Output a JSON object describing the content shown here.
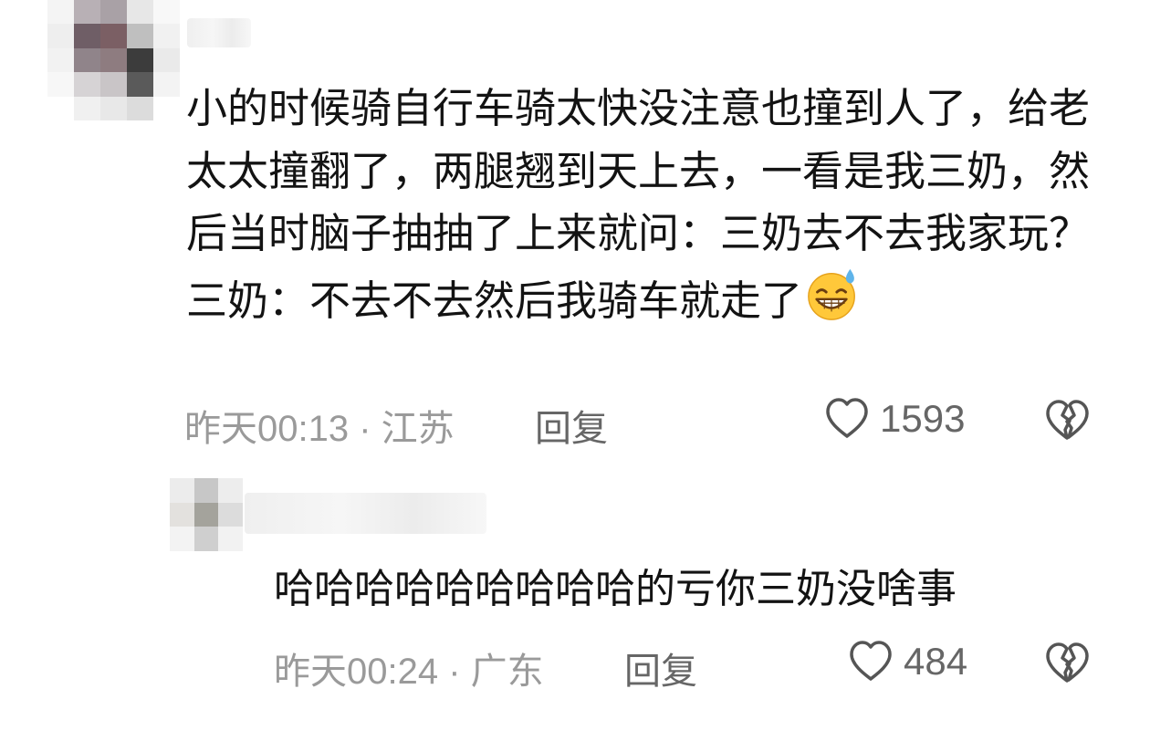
{
  "comments": [
    {
      "text": "小的时候骑自行车骑太快没注意也撞到人了，给老太太撞翻了，两腿翘到天上去，一看是我三奶，然后当时脑子抽抽了上来就问：三奶去不去我家玩？三奶：不去不去然后我骑车就走了",
      "emoji": "grinning-sweat-emoji",
      "timestamp": "昨天00:13",
      "separator": " · ",
      "location": "江苏",
      "reply_label": "回复",
      "likes": "1593"
    },
    {
      "text": "哈哈哈哈哈哈哈哈哈的亏你三奶没啥事",
      "timestamp": "昨天00:24",
      "separator": " · ",
      "location": "广东",
      "reply_label": "回复",
      "likes": "484"
    }
  ],
  "icons": {
    "like": "heart-outline-icon",
    "dislike": "broken-heart-icon"
  },
  "colors": {
    "text": "#131313",
    "meta": "#9a9a9a",
    "action": "#666666",
    "emoji_face": "#ffc83a",
    "emoji_sweat": "#5fb4ea"
  }
}
